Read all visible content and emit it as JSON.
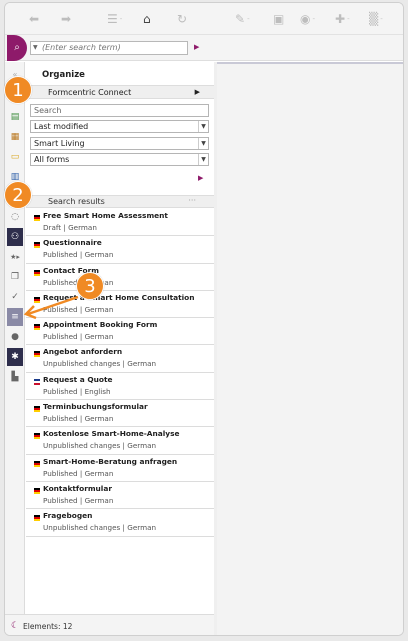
{
  "toolbar": {
    "back_icon": "arrow-left-icon",
    "forward_icon": "arrow-right-icon",
    "bookmark_icon": "bookmark-icon",
    "home_icon": "home-icon",
    "reload_icon": "reload-icon",
    "edit_icon": "pencil-icon",
    "save_icon": "save-icon",
    "preview_icon": "eye-icon",
    "add_icon": "plus-icon",
    "delete_icon": "trash-icon",
    "dropdown_marker": "-"
  },
  "search": {
    "placeholder": "(Enter search term)"
  },
  "panel": {
    "title": "Organize",
    "site": "Formcentric Connect",
    "search_field": "Search",
    "sort": "Last modified",
    "site_filter": "Smart Living",
    "type_filter": "All forms",
    "results_header": "Search results",
    "results_more": "···"
  },
  "results": [
    {
      "title": "Free Smart Home Assessment",
      "status": "Draft | German"
    },
    {
      "title": "Questionnaire",
      "status": "Published | German"
    },
    {
      "title": "Contact Form",
      "status": "Published | German"
    },
    {
      "title": "Request a Smart Home Consultation",
      "status": "Published | German"
    },
    {
      "title": "Appointment Booking Form",
      "status": "Published | German"
    },
    {
      "title": "Angebot anfordern",
      "status": "Unpublished changes | German"
    },
    {
      "title": "Request a Quote",
      "status": "Published | English"
    },
    {
      "title": "Terminbuchungsformular",
      "status": "Published | German"
    },
    {
      "title": "Kostenlose Smart-Home-Analyse",
      "status": "Unpublished changes | German"
    },
    {
      "title": "Smart-Home-Beratung anfragen",
      "status": "Published | German"
    },
    {
      "title": "Kontaktformular",
      "status": "Published | German"
    },
    {
      "title": "Fragebogen",
      "status": "Unpublished changes | German"
    }
  ],
  "footer": {
    "elements": "Elements: 12"
  },
  "callouts": [
    "1",
    "2",
    "3"
  ],
  "colors": {
    "accent": "#8e1a6a",
    "callout": "#f08a24",
    "rail_dark": "#2e2e4c"
  }
}
